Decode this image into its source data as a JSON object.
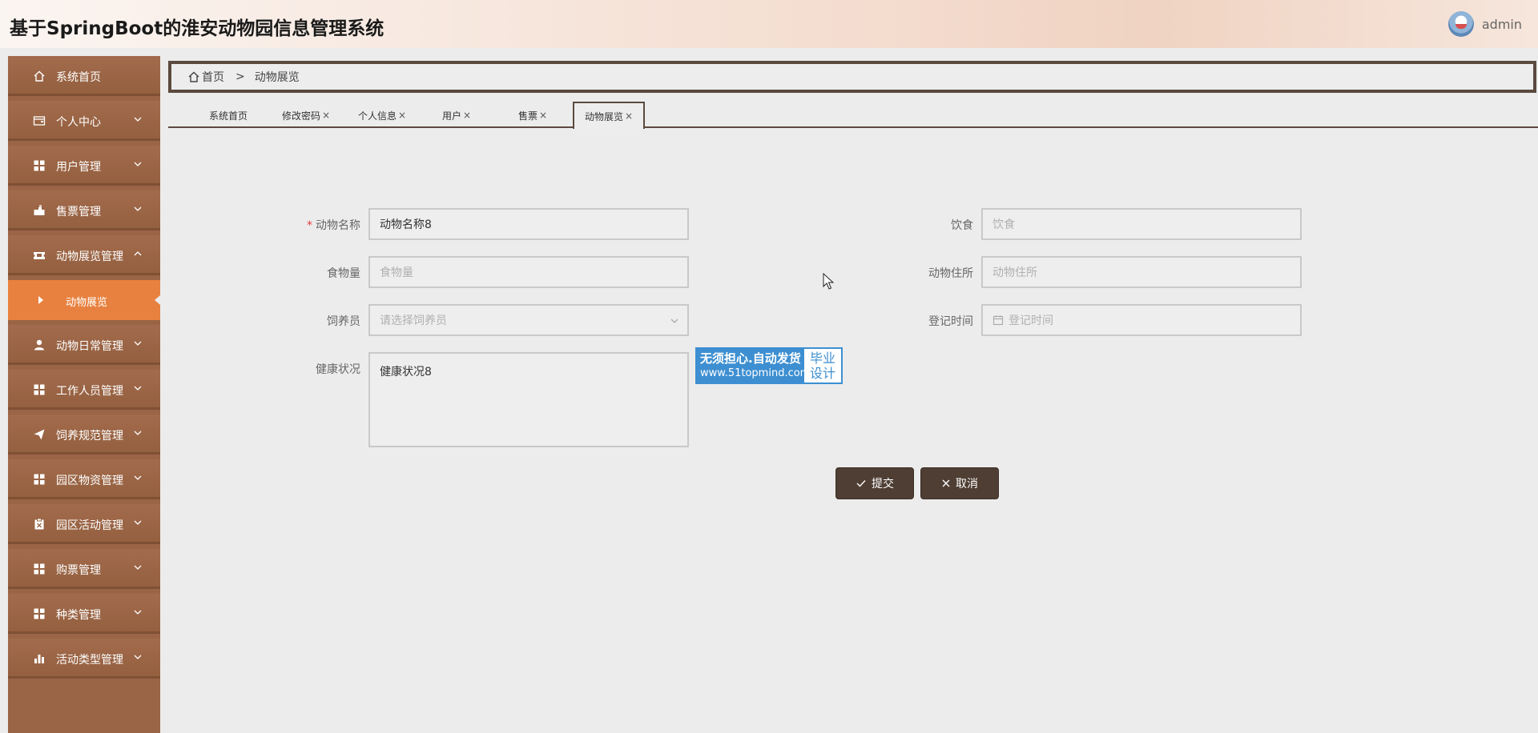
{
  "header": {
    "title": "基于SpringBoot的淮安动物园信息管理系统",
    "username": "admin"
  },
  "sidebar": {
    "items": [
      {
        "label": "系统首页",
        "icon": "home-icon"
      },
      {
        "label": "个人中心",
        "icon": "wallet-icon"
      },
      {
        "label": "用户管理",
        "icon": "grid-icon"
      },
      {
        "label": "售票管理",
        "icon": "ticket-icon"
      },
      {
        "label": "动物展览管理",
        "icon": "ticket-icon"
      },
      {
        "label": "动物日常管理",
        "icon": "user-icon"
      },
      {
        "label": "工作人员管理",
        "icon": "grid-icon"
      },
      {
        "label": "饲养规范管理",
        "icon": "send-icon"
      },
      {
        "label": "园区物资管理",
        "icon": "grid-icon"
      },
      {
        "label": "园区活动管理",
        "icon": "clipboard-icon"
      },
      {
        "label": "购票管理",
        "icon": "grid-icon"
      },
      {
        "label": "种类管理",
        "icon": "grid-icon"
      },
      {
        "label": "活动类型管理",
        "icon": "bar-chart-icon"
      }
    ],
    "active_sub": "动物展览"
  },
  "breadcrumb": {
    "home": "首页",
    "separator": ">",
    "current": "动物展览"
  },
  "tabs": [
    {
      "label": "系统首页",
      "closable": false
    },
    {
      "label": "修改密码",
      "closable": true
    },
    {
      "label": "个人信息",
      "closable": true
    },
    {
      "label": "用户",
      "closable": true
    },
    {
      "label": "售票",
      "closable": true
    },
    {
      "label": "动物展览",
      "closable": true,
      "active": true
    }
  ],
  "tab_close": "×",
  "form": {
    "name_label": "动物名称",
    "name_value": "动物名称8",
    "required_mark": "*",
    "diet_label": "饮食",
    "diet_placeholder": "饮食",
    "food_label": "食物量",
    "food_placeholder": "食物量",
    "habitat_label": "动物住所",
    "habitat_placeholder": "动物住所",
    "keeper_label": "饲养员",
    "keeper_placeholder": "请选择饲养员",
    "regtime_label": "登记时间",
    "regtime_placeholder": "登记时间",
    "health_label": "健康状况",
    "health_value": "健康状况8"
  },
  "watermark": {
    "line1": "无须担心.自动发货",
    "line2": "www.51topmind.com",
    "right1": "毕业",
    "right2": "设计"
  },
  "buttons": {
    "submit": "提交",
    "cancel": "取消"
  },
  "colors": {
    "sidebar": "#9a6446",
    "active_sub": "#e8813f",
    "dark_brown": "#4f3e33",
    "watermark_blue": "#3d8fd1"
  }
}
